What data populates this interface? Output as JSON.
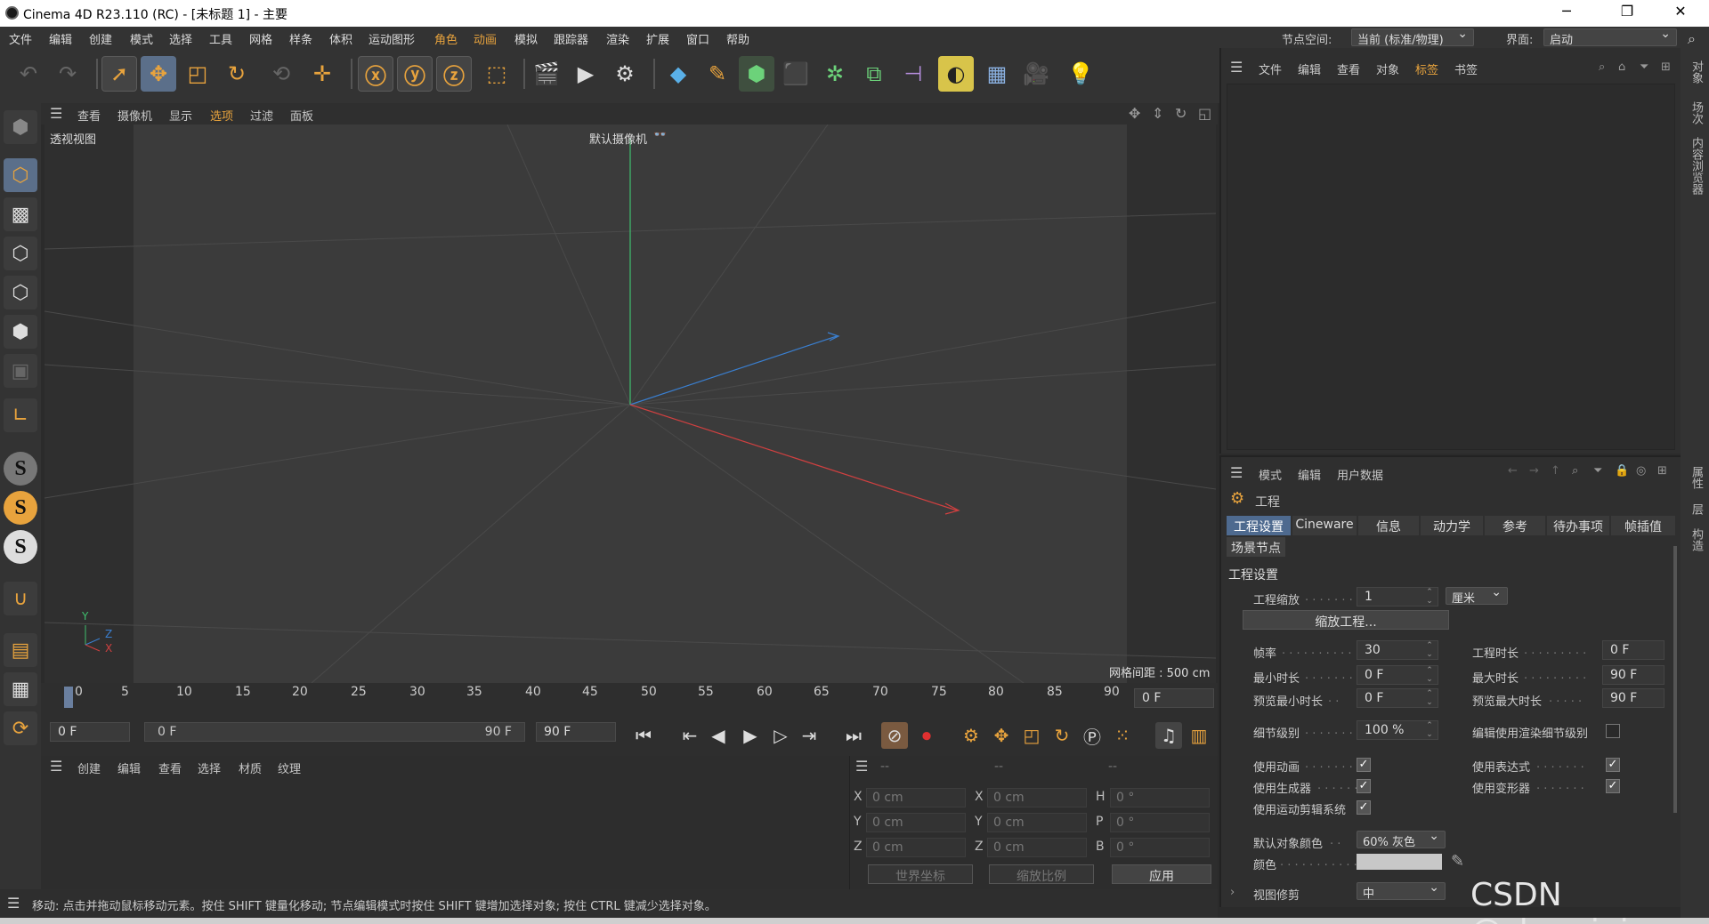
{
  "window": {
    "title": "Cinema 4D R23.110 (RC) - [未标题 1] - 主要",
    "controls": [
      "─",
      "❐",
      "✕"
    ]
  },
  "menubar": {
    "items": [
      "文件",
      "编辑",
      "创建",
      "模式",
      "选择",
      "工具",
      "网格",
      "样条",
      "体积",
      "运动图形",
      "角色",
      "动画",
      "模拟",
      "跟踪器",
      "渲染",
      "扩展",
      "窗口",
      "帮助"
    ],
    "node_space_label": "节点空间:",
    "node_space_value": "当前 (标准/物理)",
    "layout_label": "界面:",
    "layout_value": "启动"
  },
  "viewport": {
    "menu": [
      "查看",
      "摄像机",
      "显示",
      "选项",
      "过滤",
      "面板"
    ],
    "view_name": "透视视图",
    "camera_name": "默认摄像机",
    "grid_spacing": "网格间距 : 500 cm",
    "axis_labels": {
      "y": "Y",
      "z": "Z",
      "x": "X"
    },
    "colors": {
      "y_axis": "#3fbf6e",
      "x_axis": "#d04040",
      "z_axis": "#3a7fd0"
    }
  },
  "timeline": {
    "ticks": [
      "0",
      "5",
      "10",
      "15",
      "20",
      "25",
      "30",
      "35",
      "40",
      "45",
      "50",
      "55",
      "60",
      "65",
      "70",
      "75",
      "80",
      "85",
      "90"
    ],
    "current_frame": "0 F"
  },
  "transport": {
    "start": "0 F",
    "range_start": "0 F",
    "range_end": "90 F",
    "end": "90 F"
  },
  "material_panel": {
    "menu": [
      "创建",
      "编辑",
      "查看",
      "选择",
      "材质",
      "纹理"
    ]
  },
  "coords": {
    "headers": [
      "--",
      "--",
      "--"
    ],
    "rows": [
      {
        "l1": "X",
        "v1": "0 cm",
        "l2": "X",
        "v2": "0 cm",
        "l3": "H",
        "v3": "0 °"
      },
      {
        "l1": "Y",
        "v1": "0 cm",
        "l2": "Y",
        "v2": "0 cm",
        "l3": "P",
        "v3": "0 °"
      },
      {
        "l1": "Z",
        "v1": "0 cm",
        "l2": "Z",
        "v2": "0 cm",
        "l3": "B",
        "v3": "0 °"
      }
    ],
    "world": "世界坐标",
    "scale": "缩放比例",
    "apply": "应用"
  },
  "status": "移动: 点击并拖动鼠标移动元素。按住 SHIFT 键量化移动; 节点编辑模式时按住 SHIFT 键增加选择对象; 按住 CTRL 键减少选择对象。",
  "object_panel": {
    "menu": [
      "文件",
      "编辑",
      "查看",
      "对象",
      "标签",
      "书签"
    ]
  },
  "attr_panel": {
    "menu": [
      "模式",
      "编辑",
      "用户数据"
    ],
    "title": "工程",
    "tabs": [
      "工程设置",
      "Cineware",
      "信息",
      "动力学",
      "参考",
      "待办事项",
      "帧插值"
    ],
    "subtab": "场景节点",
    "section": "工程设置",
    "project_scale_label": "工程缩放",
    "project_scale_value": "1",
    "project_scale_unit": "厘米",
    "scale_project_btn": "缩放工程...",
    "fps_label": "帧率",
    "fps_value": "30",
    "project_time_label": "工程时长",
    "project_time_value": "0 F",
    "min_time_label": "最小时长",
    "min_time_value": "0 F",
    "max_time_label": "最大时长",
    "max_time_value": "90 F",
    "preview_min_label": "预览最小时长",
    "preview_min_value": "0 F",
    "preview_max_label": "预览最大时长",
    "preview_max_value": "90 F",
    "lod_label": "细节级别",
    "lod_value": "100 %",
    "render_lod_label": "编辑使用渲染细节级别",
    "use_anim_label": "使用动画",
    "use_expr_label": "使用表达式",
    "use_gen_label": "使用生成器",
    "use_deform_label": "使用变形器",
    "use_motion_label": "使用运动剪辑系统",
    "default_color_label": "默认对象颜色",
    "default_color_value": "60% 灰色",
    "color_label": "颜色",
    "view_clip_label": "视图修剪",
    "view_clip_value": "中"
  },
  "side_tabs": [
    "对象",
    "场次",
    "内容浏览器",
    "属性",
    "层",
    "构造"
  ],
  "watermark": "CSDN @zhmeiqi"
}
